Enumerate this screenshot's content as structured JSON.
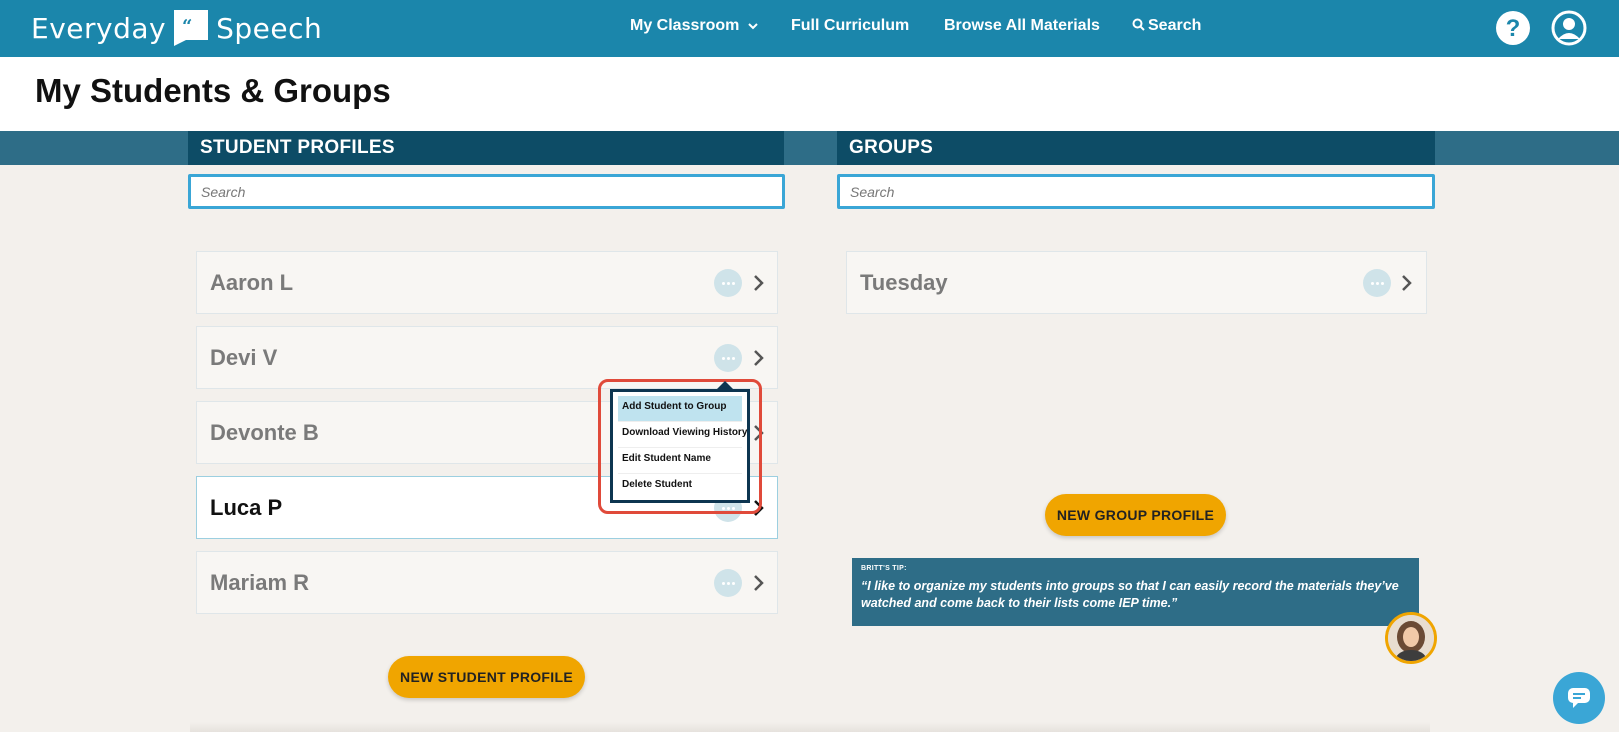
{
  "app": {
    "logo_left": "Everyday",
    "logo_right": "Speech",
    "accent": "#1b86ab",
    "highlight_color": "#e04a3a"
  },
  "nav": {
    "items": [
      {
        "label": "My Classroom",
        "has_dropdown": true
      },
      {
        "label": "Full Curriculum"
      },
      {
        "label": "Browse All Materials"
      },
      {
        "label": "Search",
        "icon": "search-icon"
      }
    ],
    "right_icons": [
      "help-icon",
      "account-icon"
    ]
  },
  "page": {
    "title": "My Students & Groups"
  },
  "students": {
    "header": "STUDENT PROFILES",
    "search_placeholder": "Search",
    "items": [
      {
        "name": "Aaron L"
      },
      {
        "name": "Devi V"
      },
      {
        "name": "Devonte B"
      },
      {
        "name": "Luca P",
        "active": true
      },
      {
        "name": "Mariam R"
      }
    ],
    "new_button": "NEW STUDENT PROFILE"
  },
  "menu": {
    "items": [
      {
        "label": "Add Student to Group",
        "selected": true
      },
      {
        "label": "Download Viewing History"
      },
      {
        "label": "Edit Student Name"
      },
      {
        "label": "Delete Student"
      }
    ]
  },
  "groups": {
    "header": "GROUPS",
    "search_placeholder": "Search",
    "items": [
      {
        "name": "Tuesday"
      }
    ],
    "new_button": "NEW GROUP PROFILE"
  },
  "tip": {
    "label": "BRITT'S TIP:",
    "text": "“I like to organize my students into groups so that I can easily record the materials they’ve watched and come back to their lists come IEP time.”"
  }
}
